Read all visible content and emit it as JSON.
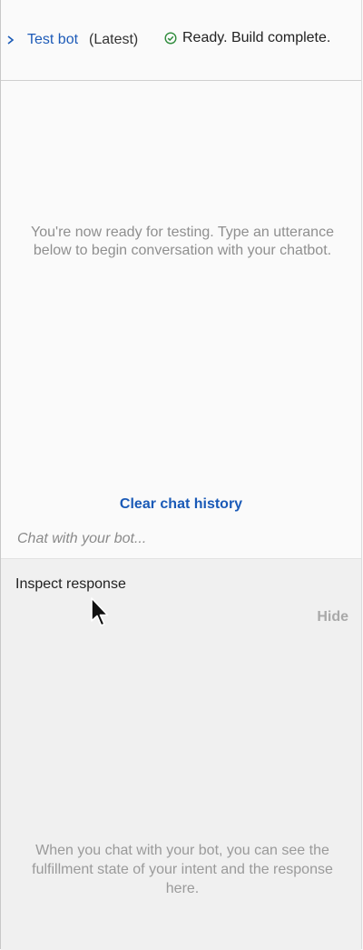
{
  "header": {
    "bot_name": "Test bot",
    "version": "(Latest)",
    "status_text": "Ready. Build complete.",
    "status_icon": "check-circle-icon",
    "status_color": "#2e8b3b"
  },
  "chat": {
    "empty_message": "You're now ready for testing. Type an utterance below to begin conversation with your chatbot.",
    "clear_label": "Clear chat history",
    "input_placeholder": "Chat with your bot...",
    "input_value": ""
  },
  "inspect": {
    "title": "Inspect response",
    "hide_label": "Hide",
    "empty_message": "When you chat with your bot, you can see the fulfillment state of your intent and the response here."
  },
  "colors": {
    "link": "#1a5ab7",
    "muted": "#8f8f8f"
  }
}
